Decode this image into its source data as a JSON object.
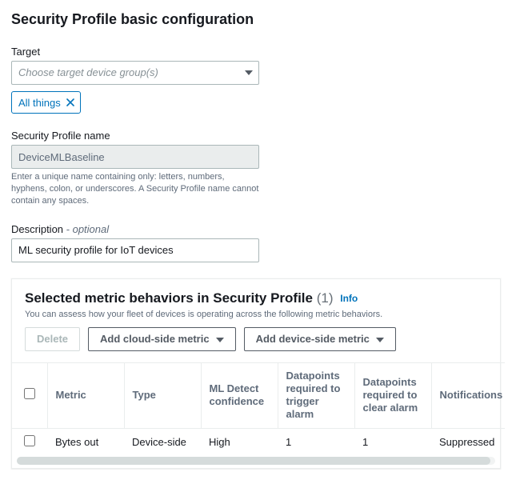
{
  "page_title": "Security Profile basic configuration",
  "target": {
    "label": "Target",
    "placeholder": "Choose target device group(s)",
    "token": "All things"
  },
  "name_field": {
    "label": "Security Profile name",
    "value": "DeviceMLBaseline",
    "hint": "Enter a unique name containing only: letters, numbers, hyphens, colon, or underscores. A Security Profile name cannot contain any spaces."
  },
  "description_field": {
    "label": "Description",
    "optional": "- optional",
    "value": "ML security profile for IoT devices"
  },
  "behaviors": {
    "title": "Selected metric behaviors in Security Profile",
    "count": "(1)",
    "info": "Info",
    "subtitle": "You can assess how your fleet of devices is operating across the following metric behaviors.",
    "buttons": {
      "delete": "Delete",
      "add_cloud": "Add cloud-side metric",
      "add_device": "Add device-side metric"
    },
    "columns": {
      "metric": "Metric",
      "type": "Type",
      "ml_conf": "ML Detect confidence",
      "dp_trigger": "Datapoints required to trigger alarm",
      "dp_clear": "Datapoints required to clear alarm",
      "notif": "Notifications"
    },
    "rows": [
      {
        "metric": "Bytes out",
        "type": "Device-side",
        "ml_conf": "High",
        "dp_trigger": "1",
        "dp_clear": "1",
        "notif": "Suppressed"
      }
    ]
  }
}
